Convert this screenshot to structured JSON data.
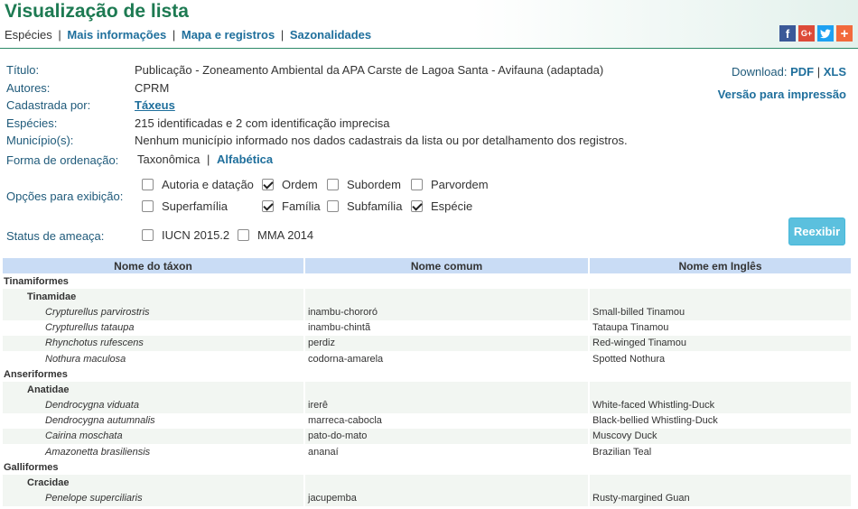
{
  "header": {
    "title": "Visualização de lista",
    "nav": {
      "current": "Espécies",
      "sep": "|",
      "links": [
        "Mais informações",
        "Mapa e registros",
        "Sazonalidades"
      ]
    },
    "social": {
      "facebook": "f",
      "google_plus": "G+",
      "twitter": "twitter-bird",
      "more": "+"
    }
  },
  "meta": {
    "rows": [
      {
        "label": "Título:",
        "value": "Publicação - Zoneamento Ambiental da APA Carste de Lagoa Santa - Avifauna (adaptada)"
      },
      {
        "label": "Autores:",
        "value": "CPRM"
      },
      {
        "label": "Cadastrada por:",
        "value": "Táxeus"
      },
      {
        "label": "Espécies:",
        "value": "215 identificadas e 2 com identificação imprecisa"
      },
      {
        "label": "Município(s):",
        "value": "Nenhum município informado nos dados cadastrais da lista ou por detalhamento dos registros."
      }
    ]
  },
  "download": {
    "label": "Download:",
    "pdf": "PDF",
    "sep": "|",
    "xls": "XLS",
    "print": "Versão para impressão"
  },
  "sorting": {
    "label": "Forma de ordenação:",
    "taxonomic": "Taxonômica",
    "sep": "|",
    "alphabetic": "Alfabética"
  },
  "display_options": {
    "label": "Opções para exibição:",
    "options": [
      {
        "label": "Autoria e datação",
        "checked": false
      },
      {
        "label": "Ordem",
        "checked": true
      },
      {
        "label": "Subordem",
        "checked": false
      },
      {
        "label": "Parvordem",
        "checked": false
      },
      {
        "label": "Superfamília",
        "checked": false
      },
      {
        "label": "Família",
        "checked": true
      },
      {
        "label": "Subfamília",
        "checked": false
      },
      {
        "label": "Espécie",
        "checked": true
      }
    ]
  },
  "threat_status": {
    "label": "Status de ameaça:",
    "options": [
      {
        "label": "IUCN 2015.2",
        "checked": false
      },
      {
        "label": "MMA 2014",
        "checked": false
      }
    ]
  },
  "reexibir_label": "Reexibir",
  "table": {
    "headers": [
      "Nome do táxon",
      "Nome comum",
      "Nome em Inglês"
    ],
    "rows": [
      {
        "type": "order",
        "taxon": "Tinamiformes",
        "common": "",
        "english": ""
      },
      {
        "type": "family",
        "taxon": "Tinamidae",
        "common": "",
        "english": ""
      },
      {
        "type": "species",
        "taxon": "Crypturellus parvirostris",
        "common": "inambu-chororó",
        "english": "Small-billed Tinamou"
      },
      {
        "type": "species",
        "taxon": "Crypturellus tataupa",
        "common": "inambu-chintã",
        "english": "Tataupa Tinamou"
      },
      {
        "type": "species",
        "taxon": "Rhynchotus rufescens",
        "common": "perdiz",
        "english": "Red-winged Tinamou"
      },
      {
        "type": "species",
        "taxon": "Nothura maculosa",
        "common": "codorna-amarela",
        "english": "Spotted Nothura"
      },
      {
        "type": "order",
        "taxon": "Anseriformes",
        "common": "",
        "english": ""
      },
      {
        "type": "family",
        "taxon": "Anatidae",
        "common": "",
        "english": ""
      },
      {
        "type": "species",
        "taxon": "Dendrocygna viduata",
        "common": "irerê",
        "english": "White-faced Whistling-Duck"
      },
      {
        "type": "species",
        "taxon": "Dendrocygna autumnalis",
        "common": "marreca-cabocla",
        "english": "Black-bellied Whistling-Duck"
      },
      {
        "type": "species",
        "taxon": "Cairina moschata",
        "common": "pato-do-mato",
        "english": "Muscovy Duck"
      },
      {
        "type": "species",
        "taxon": "Amazonetta brasiliensis",
        "common": "ananaí",
        "english": "Brazilian Teal"
      },
      {
        "type": "order",
        "taxon": "Galliformes",
        "common": "",
        "english": ""
      },
      {
        "type": "family",
        "taxon": "Cracidae",
        "common": "",
        "english": ""
      },
      {
        "type": "species",
        "taxon": "Penelope superciliaris",
        "common": "jacupemba",
        "english": "Rusty-margined Guan"
      }
    ]
  }
}
